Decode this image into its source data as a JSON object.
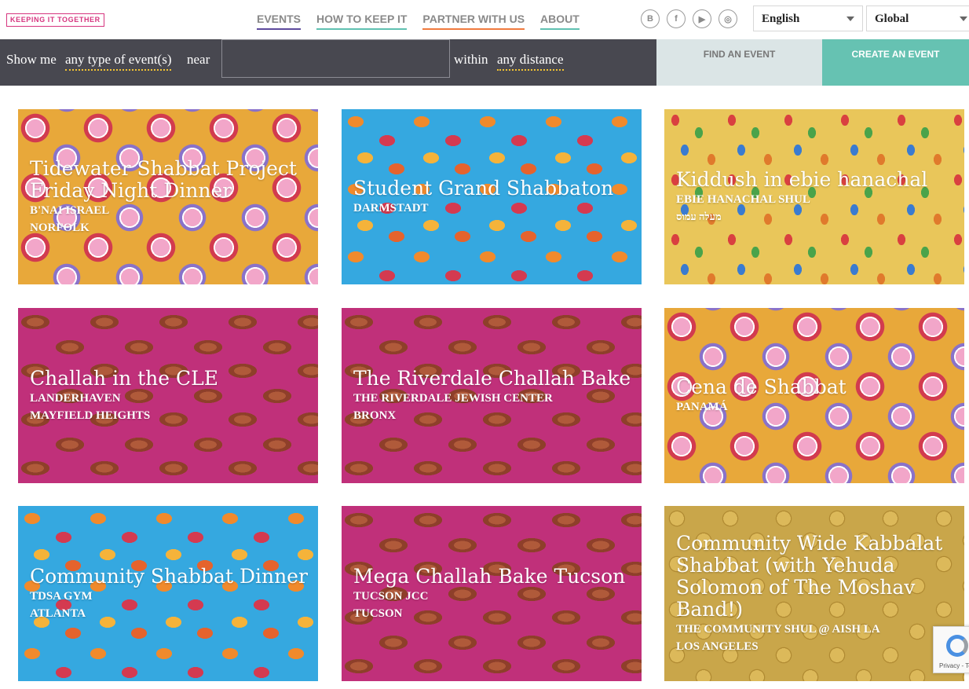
{
  "header": {
    "logo_text": "KEEPING IT TOGETHER",
    "nav": [
      {
        "label": "EVENTS"
      },
      {
        "label": "HOW TO KEEP IT"
      },
      {
        "label": "PARTNER WITH US"
      },
      {
        "label": "ABOUT"
      }
    ],
    "social": [
      {
        "icon": "blog-icon",
        "glyph": "B"
      },
      {
        "icon": "facebook-icon",
        "glyph": "f"
      },
      {
        "icon": "youtube-icon",
        "glyph": "▶"
      },
      {
        "icon": "instagram-icon",
        "glyph": "◎"
      }
    ],
    "language_select": "English",
    "region_select": "Global"
  },
  "search": {
    "show_me": "Show me",
    "event_type": "any type of event(s)",
    "near": "near",
    "location_value": "",
    "within": "within",
    "distance": "any distance",
    "find_button": "FIND AN EVENT",
    "create_button": "CREATE AN EVENT"
  },
  "events": [
    {
      "title": "Tidewater Shabbat Project Friday Night Dinner",
      "venue": "B'NAI ISRAEL",
      "city": "NORFOLK",
      "pattern": "plates"
    },
    {
      "title": "Student Grand Shabbaton",
      "venue": "DARMSTADT",
      "city": "",
      "pattern": "beans"
    },
    {
      "title": "Kiddush in ebie hanachal",
      "venue": "EBIE HANACHAL SHUL",
      "city": "מעלה עמוס",
      "pattern": "jelly"
    },
    {
      "title": "Challah in the CLE",
      "venue": "LANDERHAVEN",
      "city": "MAYFIELD HEIGHTS",
      "pattern": "challah"
    },
    {
      "title": "The Riverdale Challah Bake",
      "venue": "THE RIVERDALE JEWISH CENTER",
      "city": "BRONX",
      "pattern": "challah"
    },
    {
      "title": "Cena de Shabbat",
      "venue": "PANAMÁ",
      "city": "",
      "pattern": "plates"
    },
    {
      "title": "Community Shabbat Dinner",
      "venue": "TDSA GYM",
      "city": "ATLANTA",
      "pattern": "beans"
    },
    {
      "title": "Mega Challah Bake Tucson",
      "venue": "TUCSON JCC",
      "city": "TUCSON",
      "pattern": "challah"
    },
    {
      "title": "Community Wide Kabbalat Shabbat (with Yehuda Solomon of The Moshav Band!)",
      "venue": "THE COMMUNITY SHUL @ AISH LA",
      "city": "LOS ANGELES",
      "pattern": "kugel"
    }
  ],
  "recaptcha": {
    "text": "Privacy - Te"
  }
}
